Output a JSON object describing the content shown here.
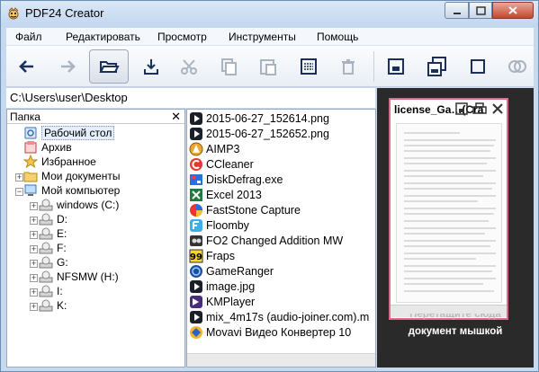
{
  "window": {
    "title": "PDF24 Creator"
  },
  "menu": [
    "Файл",
    "Редактировать",
    "Просмотр",
    "Инструменты",
    "Помощь"
  ],
  "toolbar": {
    "buttons": [
      "back-icon",
      "forward-icon",
      "open-folder-icon",
      "import-icon",
      "cut-icon",
      "copy-icon",
      "paste-icon",
      "compress-icon",
      "delete-icon",
      "save-icon",
      "save-as-icon",
      "crop-icon",
      "merge-icon"
    ]
  },
  "path": "C:\\Users\\user\\Desktop",
  "folders": {
    "header": "Папка",
    "close": "✕",
    "items": [
      {
        "label": "Рабочий стол",
        "icon": "desktop-icon"
      },
      {
        "label": "Архив",
        "icon": "archive-icon"
      },
      {
        "label": "Избранное",
        "icon": "star-icon"
      },
      {
        "label": "Мои документы",
        "icon": "folder-icon"
      },
      {
        "label": "Мой компьютер",
        "icon": "computer-icon"
      },
      {
        "label": "windows (C:)",
        "icon": "drive-icon"
      },
      {
        "label": "D:",
        "icon": "drive-icon"
      },
      {
        "label": "E:",
        "icon": "drive-icon"
      },
      {
        "label": "F:",
        "icon": "drive-icon"
      },
      {
        "label": "G:",
        "icon": "drive-icon"
      },
      {
        "label": "NFSMW (H:)",
        "icon": "drive-icon"
      },
      {
        "label": "I:",
        "icon": "drive-icon"
      },
      {
        "label": "K:",
        "icon": "drive-icon"
      }
    ]
  },
  "files": [
    {
      "name": "2015-06-27_152614.png",
      "icon": "media-icon"
    },
    {
      "name": "2015-06-27_152652.png",
      "icon": "media-icon"
    },
    {
      "name": "AIMP3",
      "icon": "aimp-icon"
    },
    {
      "name": "CCleaner",
      "icon": "ccleaner-icon"
    },
    {
      "name": "DiskDefrag.exe",
      "icon": "defrag-icon"
    },
    {
      "name": "Excel 2013",
      "icon": "excel-icon"
    },
    {
      "name": "FastStone Capture",
      "icon": "faststone-icon"
    },
    {
      "name": "Floomby",
      "icon": "floomby-icon"
    },
    {
      "name": "FO2 Changed Addition MW",
      "icon": "game-icon"
    },
    {
      "name": "Fraps",
      "icon": "fraps-icon"
    },
    {
      "name": "GameRanger",
      "icon": "gameranger-icon"
    },
    {
      "name": "image.jpg",
      "icon": "media-icon"
    },
    {
      "name": "KMPlayer",
      "icon": "kmplayer-icon"
    },
    {
      "name": "mix_4m17s (audio-joiner.com).m",
      "icon": "media-icon"
    },
    {
      "name": "Movavi Видео Конвертер 10",
      "icon": "movavi-icon"
    }
  ],
  "preview": {
    "title": "license_Ga…(Cra",
    "hint_line1": "Перетащите сюда",
    "hint_line2": "документ мышкой"
  }
}
